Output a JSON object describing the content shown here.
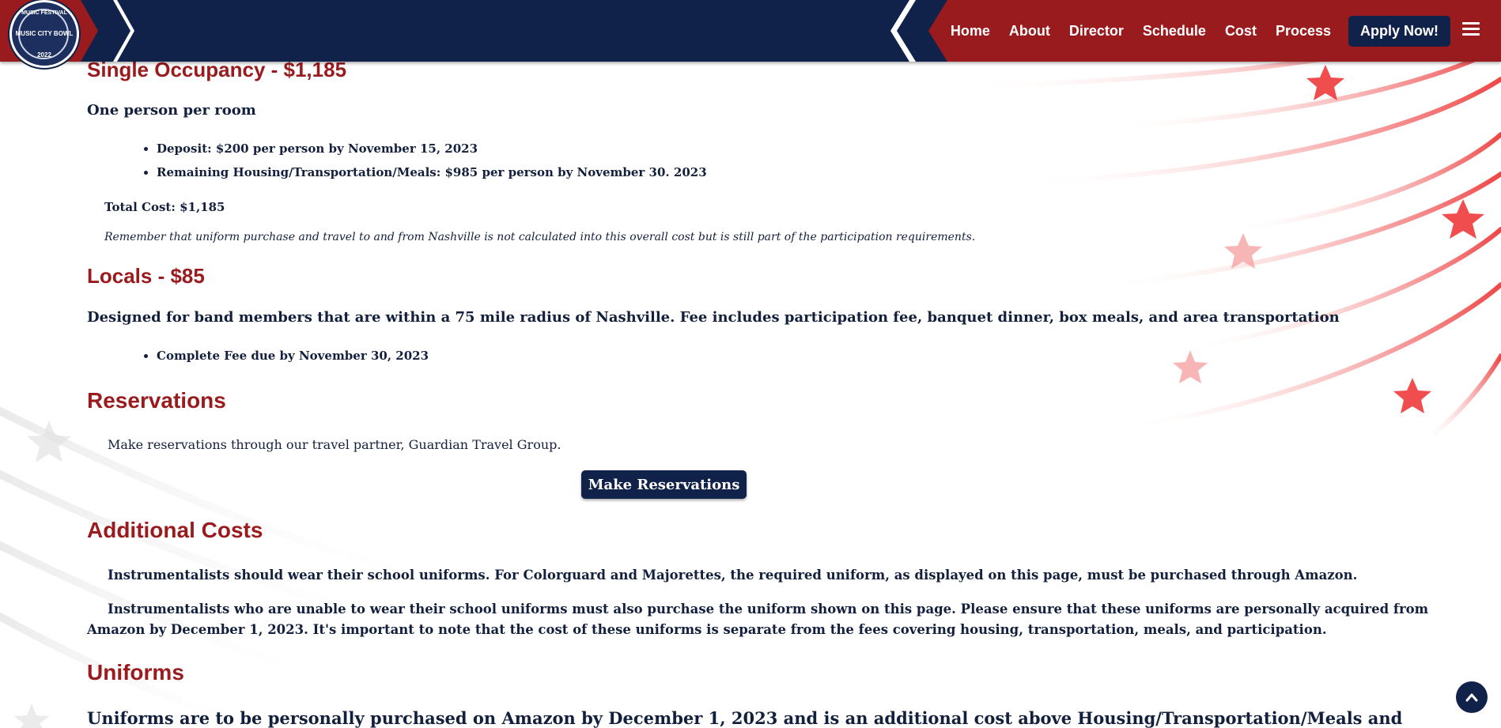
{
  "nav": {
    "logo_top": "MUSIC FESTIVAL",
    "logo_center": "MUSIC CITY BOWL",
    "logo_year": "2022",
    "links": [
      "Home",
      "About",
      "Director",
      "Schedule",
      "Cost",
      "Process"
    ],
    "apply": "Apply Now!",
    "menu_icon": "hamburger-menu-icon"
  },
  "single": {
    "heading": "Single Occupancy - $1,185",
    "sub": "One person per room",
    "bullets": [
      "Deposit: $200 per person by November 15, 2023",
      "Remaining Housing/Transportation/Meals: $985 per person by November 30. 2023"
    ],
    "total": "Total Cost: $1,185",
    "note": "Remember that uniform purchase and travel to and from Nashville is not calculated into this overall cost but is still part of the participation requirements."
  },
  "locals": {
    "heading": "Locals - $85",
    "sub": "Designed for band members that are within a 75 mile radius of Nashville. Fee includes participation fee, banquet dinner, box meals, and area transportation",
    "bullets": [
      "Complete Fee due by November 30, 2023"
    ]
  },
  "reservations": {
    "heading": "Reservations",
    "text": "Make reservations through our travel partner, Guardian Travel Group.",
    "button": "Make Reservations"
  },
  "additional": {
    "heading": "Additional Costs",
    "p1": "Instrumentalists should wear their school uniforms. For Colorguard and Majorettes, the required uniform, as displayed on this page, must be purchased through Amazon.",
    "p2a": "Instrumentalists who are unable to wear their school uniforms must also purchase the uniform shown on this page. Please ensure that these uniforms are personally acquired from",
    "p2b": "Amazon by December 1, 2023. It's important to note that the cost of these uniforms is separate from the fees covering housing, transportation, meals, and participation."
  },
  "uniforms": {
    "heading": "Uniforms",
    "text": "Uniforms are to be personally purchased on Amazon by December 1, 2023 and is an additional cost above Housing/Transportation/Meals and"
  },
  "colors": {
    "navy": "#10224a",
    "red": "#9a1b1e",
    "text": "#13203d"
  },
  "scroll_top_icon": "chevron-up-icon"
}
